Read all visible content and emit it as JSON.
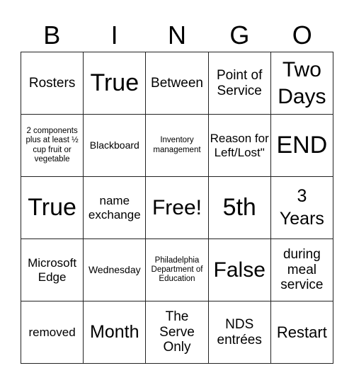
{
  "header": [
    "B",
    "I",
    "N",
    "G",
    "O"
  ],
  "cells": [
    {
      "text": "Rosters",
      "size": "s19"
    },
    {
      "text": "True",
      "size": "s34"
    },
    {
      "text": "Between",
      "size": "s19"
    },
    {
      "text": "Point of Service",
      "size": "s19"
    },
    {
      "text": "Two Days",
      "size": "s30"
    },
    {
      "text": "2 components plus at least ½ cup fruit or vegetable",
      "size": "s11"
    },
    {
      "text": "Blackboard",
      "size": "s13"
    },
    {
      "text": "Inventory management",
      "size": "s11"
    },
    {
      "text": "Reason for Left/Lost\"",
      "size": "s16"
    },
    {
      "text": "END",
      "size": "s34"
    },
    {
      "text": "True",
      "size": "s34"
    },
    {
      "text": "name exchange",
      "size": "s16"
    },
    {
      "text": "Free!",
      "size": "s30"
    },
    {
      "text": "5th",
      "size": "s34"
    },
    {
      "text": "3 Years",
      "size": "s24"
    },
    {
      "text": "Microsoft Edge",
      "size": "s16"
    },
    {
      "text": "Wednesday",
      "size": "s13"
    },
    {
      "text": "Philadelphia Department of Education",
      "size": "s11"
    },
    {
      "text": "False",
      "size": "s30"
    },
    {
      "text": "during meal service",
      "size": "s19"
    },
    {
      "text": "removed",
      "size": "s16"
    },
    {
      "text": "Month",
      "size": "s24"
    },
    {
      "text": "The Serve Only",
      "size": "s19"
    },
    {
      "text": "NDS entrées",
      "size": "s19"
    },
    {
      "text": "Restart",
      "size": "s22"
    }
  ]
}
